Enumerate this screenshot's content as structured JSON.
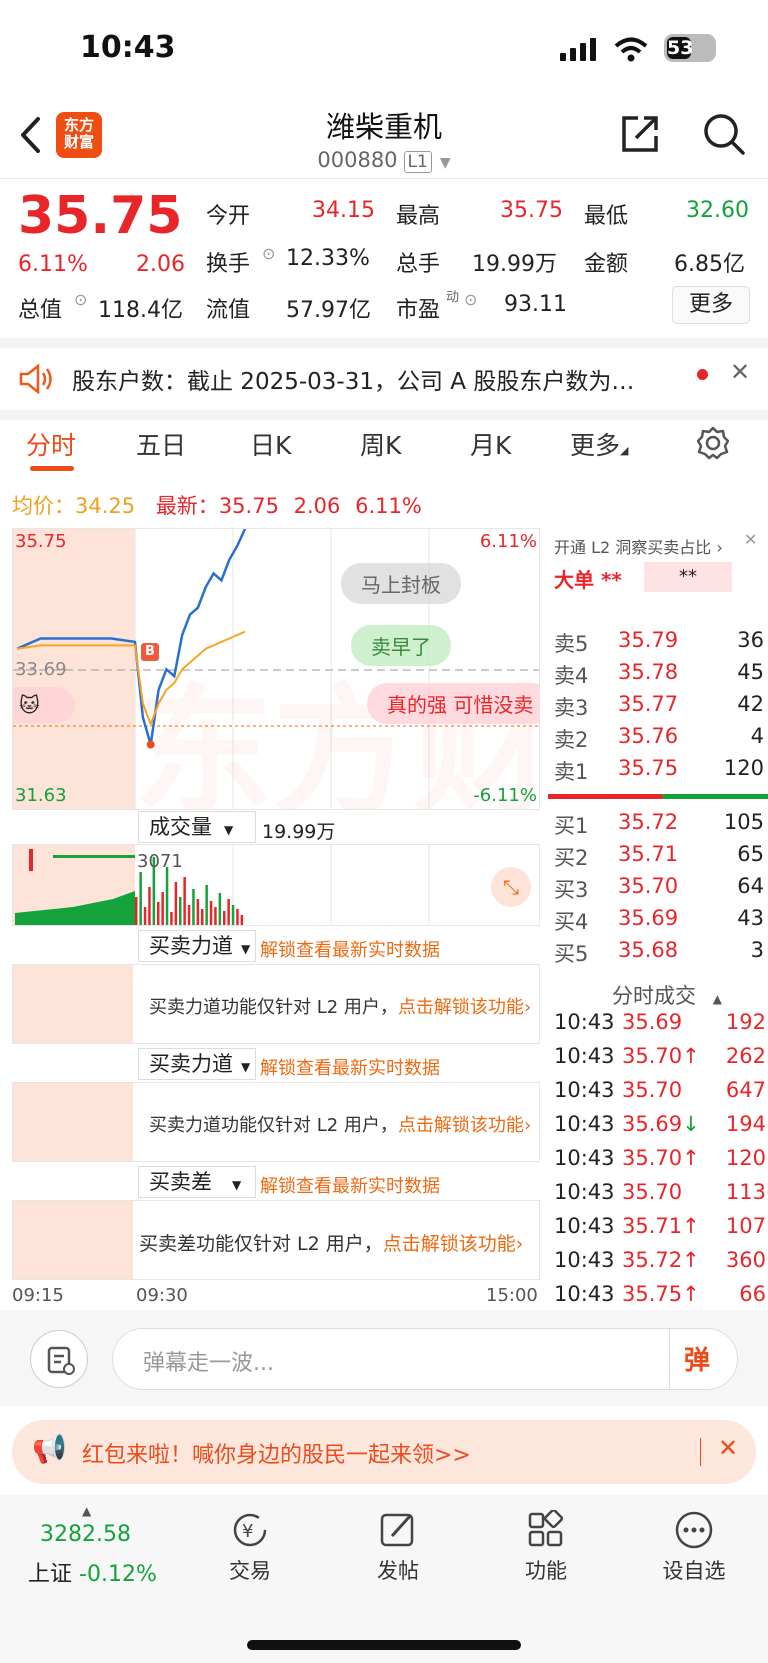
{
  "status_bar": {
    "time": "10:43",
    "battery": "53"
  },
  "header": {
    "logo_text": "东方\n财富",
    "stock_name": "潍柴重机",
    "stock_code": "000880",
    "level_badge": "L1"
  },
  "quote": {
    "price": "35.75",
    "change_pct": "6.11%",
    "change": "2.06",
    "open_label": "今开",
    "open": "34.15",
    "high_label": "最高",
    "high": "35.75",
    "low_label": "最低",
    "low": "32.60",
    "turnover_label": "换手",
    "turnover": "12.33%",
    "volume_label": "总手",
    "volume": "19.99万",
    "amount_label": "金额",
    "amount": "6.85亿",
    "total_cap_label": "总值",
    "total_cap": "118.4亿",
    "float_cap_label": "流值",
    "float_cap": "57.97亿",
    "pe_label": "市盈",
    "pe_sup": "动",
    "pe": "93.11",
    "more_button": "更多"
  },
  "notice": {
    "text": "股东户数：截止 2025-03-31，公司 A 股股东户数为…"
  },
  "tabs": [
    "分时",
    "五日",
    "日K",
    "周K",
    "月K",
    "更多"
  ],
  "chart_header": {
    "avg_label": "均价：",
    "avg": "34.25",
    "latest_label": "最新：",
    "latest": "35.75",
    "change": "2.06",
    "pct": "6.11%"
  },
  "intraday": {
    "y_top": "35.75",
    "y_mid": "33.69",
    "y_bottom": "31.63",
    "pct_top": "6.11%",
    "pct_bottom": "-6.11%",
    "buy_marker": "B",
    "watermark": "东方财富",
    "danmaku": [
      "马上封板",
      "卖早了",
      "真的强 可惜没卖"
    ]
  },
  "chart_data": {
    "type": "line",
    "title": "",
    "ylim": [
      31.63,
      35.75
    ],
    "reference": 33.69,
    "series": [
      {
        "name": "",
        "values": [
          34.0,
          34.15,
          34.15,
          34.15,
          34.15,
          34.1,
          33.0,
          32.6,
          33.4,
          33.7,
          33.6,
          34.2,
          34.5,
          34.6,
          34.9,
          35.1,
          35.0,
          35.3,
          35.5,
          35.75
        ]
      },
      {
        "name": "",
        "values": [
          34.0,
          34.05,
          34.05,
          34.05,
          34.05,
          34.05,
          33.2,
          32.9,
          33.2,
          33.4,
          33.5,
          33.7,
          33.8,
          33.9,
          34.0,
          34.05,
          34.1,
          34.15,
          34.2,
          34.25
        ]
      }
    ]
  },
  "volume_panel": {
    "selector": "成交量",
    "value": "19.99万",
    "max": "3071"
  },
  "panels": [
    {
      "selector": "买卖力道",
      "unlock": "解锁查看最新实时数据",
      "msg": "买卖力道功能仅针对 L2 用户，",
      "link": "点击解锁该功能"
    },
    {
      "selector": "买卖力道",
      "unlock": "解锁查看最新实时数据",
      "msg": "买卖力道功能仅针对 L2 用户，",
      "link": "点击解锁该功能"
    },
    {
      "selector": "买卖差",
      "unlock": "解锁查看最新实时数据",
      "msg": "买卖差功能仅针对 L2 用户，",
      "link": "点击解锁该功能"
    }
  ],
  "time_axis": {
    "start": "09:15",
    "mid": "09:30",
    "end": "15:00"
  },
  "l2_promo": {
    "text": "开通 L2 洞察买卖占比",
    "big_order": "大单",
    "mask1": "**",
    "mask2": "**"
  },
  "asks": [
    {
      "label": "卖5",
      "price": "35.79",
      "vol": "36"
    },
    {
      "label": "卖4",
      "price": "35.78",
      "vol": "45"
    },
    {
      "label": "卖3",
      "price": "35.77",
      "vol": "42"
    },
    {
      "label": "卖2",
      "price": "35.76",
      "vol": "4"
    },
    {
      "label": "卖1",
      "price": "35.75",
      "vol": "120"
    }
  ],
  "bids": [
    {
      "label": "买1",
      "price": "35.72",
      "vol": "105"
    },
    {
      "label": "买2",
      "price": "35.71",
      "vol": "65"
    },
    {
      "label": "买3",
      "price": "35.70",
      "vol": "64"
    },
    {
      "label": "买4",
      "price": "35.69",
      "vol": "43"
    },
    {
      "label": "买5",
      "price": "35.68",
      "vol": "3"
    }
  ],
  "trades_title": "分时成交",
  "trades": [
    {
      "time": "10:43",
      "price": "35.69",
      "vol": "192"
    },
    {
      "time": "10:43",
      "price": "35.70↑",
      "vol": "262"
    },
    {
      "time": "10:43",
      "price": "35.70",
      "vol": "647"
    },
    {
      "time": "10:43",
      "price": "35.69↓",
      "vol": "194"
    },
    {
      "time": "10:43",
      "price": "35.70↑",
      "vol": "120"
    },
    {
      "time": "10:43",
      "price": "35.70",
      "vol": "113"
    },
    {
      "time": "10:43",
      "price": "35.71↑",
      "vol": "107"
    },
    {
      "time": "10:43",
      "price": "35.72↑",
      "vol": "360"
    },
    {
      "time": "10:43",
      "price": "35.75↑",
      "vol": "66"
    }
  ],
  "comment_bar": {
    "placeholder": "弹幕走一波...",
    "send_label": "弹"
  },
  "banner": {
    "text": "红包来啦！喊你身边的股民一起来领>>"
  },
  "bottom_nav": {
    "index_value": "3282.58",
    "index_name": "上证",
    "index_change": "-0.12%",
    "items": [
      "交易",
      "发帖",
      "功能",
      "设自选"
    ]
  }
}
